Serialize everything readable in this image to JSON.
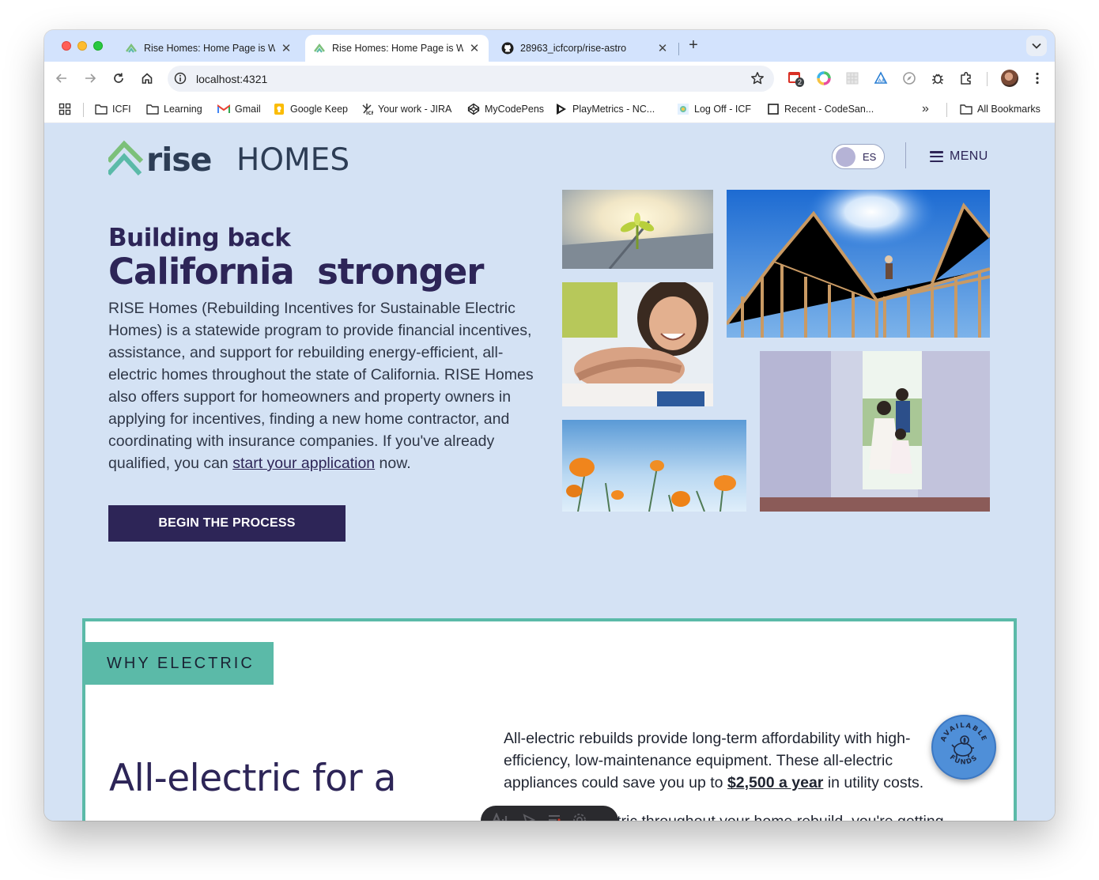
{
  "browser": {
    "tabs": [
      {
        "title": "Rise Homes: Home Page is W",
        "icon": "rise-favicon-icon",
        "active": false
      },
      {
        "title": "Rise Homes: Home Page is W",
        "icon": "rise-favicon-icon",
        "active": true
      },
      {
        "title": "28963_icfcorp/rise-astro",
        "icon": "github-icon",
        "active": false
      }
    ],
    "address": "localhost:4321",
    "extension_badge": "2",
    "bookmarks": [
      {
        "label": "ICFI",
        "icon": "folder-icon"
      },
      {
        "label": "Learning",
        "icon": "folder-icon"
      },
      {
        "label": "Gmail",
        "icon": "gmail-icon"
      },
      {
        "label": "Google Keep",
        "icon": "keep-icon"
      },
      {
        "label": "Your work - JIRA",
        "icon": "jira-icon"
      },
      {
        "label": "MyCodePens",
        "icon": "codepen-icon"
      },
      {
        "label": "PlayMetrics - NC...",
        "icon": "playmetrics-icon"
      },
      {
        "label": "Log Off - ICF",
        "icon": "icf-icon"
      },
      {
        "label": "Recent - CodeSan...",
        "icon": "codesandbox-icon"
      }
    ],
    "all_bookmarks": "All Bookmarks",
    "overflow": "»"
  },
  "header": {
    "logo_text": "Rise Homes",
    "logo_word1": "Rise",
    "logo_word2": "Homes",
    "language_toggle": "ES",
    "menu_label": "MENU"
  },
  "hero": {
    "subtitle": "Building back",
    "title": "California  stronger",
    "body_text": "RISE Homes (Rebuilding Incentives for Sustainable Electric Homes) is a statewide program to provide financial incentives, assistance, and support for rebuilding energy-efficient, all-electric homes throughout the state of California. RISE Homes also offers support for homeowners and property owners in applying for incentives, finding a new home contractor, and coordinating with insurance companies. If you've already qualified, you can ",
    "link_text": "start your application",
    "body_end": " now.",
    "cta_label": "BEGIN THE PROCESS"
  },
  "why_electric": {
    "tag": "WHY ELECTRIC",
    "title": "All-electric for a",
    "body_start": "All-electric rebuilds provide long-term affordability with high-efficiency, low-maintenance equipment. These all-electric appliances could save you up to ",
    "highlight": "$2,500 a year",
    "body_end": " in utility costs.",
    "body2": "By going all-electric throughout your home rebuild, you're getting"
  },
  "funds_badge": {
    "top_text": "AVAILABLE",
    "bottom_text": "FUNDS",
    "icon": "piggy-bank-icon"
  },
  "floating_toolbar_icons": [
    "astro-dev-toolbar-icon",
    "inspect-icon",
    "audit-icon",
    "settings-icon"
  ],
  "colors": {
    "brand_navy": "#2d2557",
    "brand_teal": "#5bbaa8",
    "page_bg": "#d4e2f4",
    "badge_blue": "#4f8fd8"
  }
}
